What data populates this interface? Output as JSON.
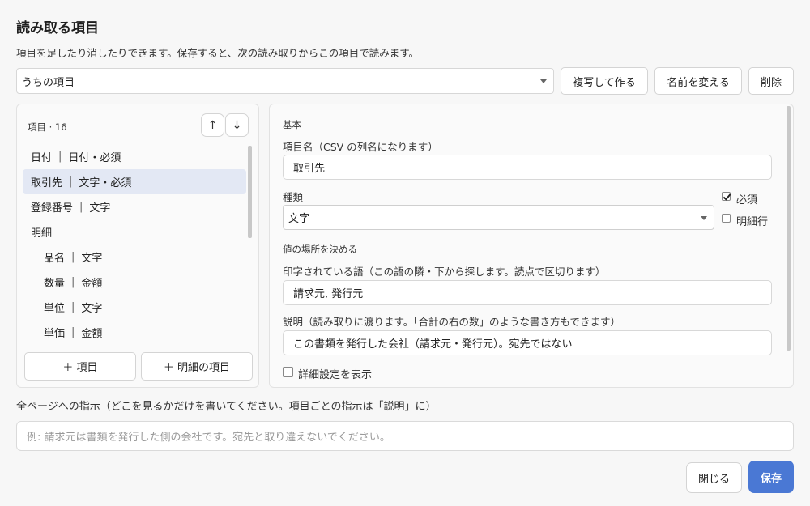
{
  "header": {
    "title": "読み取る項目",
    "subtitle": "項目を足したり消したりできます。保存すると、次の読み取りからこの項目で読みます。"
  },
  "toolbar": {
    "template_select": "うちの項目",
    "copy_label": "複写して作る",
    "rename_label": "名前を変える",
    "delete_label": "削除"
  },
  "list": {
    "header": "項目 · 16",
    "up_icon": "↑",
    "down_icon": "↓",
    "items": [
      {
        "name": "日付",
        "type": "日付・必須",
        "selected": false,
        "indent": false
      },
      {
        "name": "取引先",
        "type": "文字・必須",
        "selected": true,
        "indent": false
      },
      {
        "name": "登録番号",
        "type": "文字",
        "selected": false,
        "indent": false
      },
      {
        "name": "明細",
        "type": "",
        "selected": false,
        "indent": false
      },
      {
        "name": "品名",
        "type": "文字",
        "selected": false,
        "indent": true
      },
      {
        "name": "数量",
        "type": "金額",
        "selected": false,
        "indent": true
      },
      {
        "name": "単位",
        "type": "文字",
        "selected": false,
        "indent": true
      },
      {
        "name": "単価",
        "type": "金額",
        "selected": false,
        "indent": true
      }
    ],
    "add_item_label": "＋ 項目",
    "add_detail_label": "＋ 明細の項目"
  },
  "detail": {
    "section_basic": "基本",
    "name_label": "項目名（CSV の列名になります）",
    "name_value": "取引先",
    "type_label": "種類",
    "type_value": "文字",
    "required_label": "必須",
    "required_checked": true,
    "detail_row_label": "明細行",
    "detail_row_checked": false,
    "section_location": "値の場所を決める",
    "keywords_label": "印字されている語（この語の隣・下から探します。読点で区切ります）",
    "keywords_value": "請求元, 発行元",
    "description_label": "説明（読み取りに渡ります。「合計の右の数」のような書き方もできます）",
    "description_value": "この書類を発行した会社（請求元・発行元）。宛先ではない",
    "advanced_label": "詳細設定を表示",
    "advanced_checked": false
  },
  "instructions": {
    "label": "全ページへの指示（どこを見るかだけを書いてください。項目ごとの指示は「説明」に）",
    "placeholder": "例: 請求元は書類を発行した側の会社です。宛先と取り違えないでください。"
  },
  "footer": {
    "close_label": "閉じる",
    "save_label": "保存",
    "accent_color": "#4a78d4"
  }
}
